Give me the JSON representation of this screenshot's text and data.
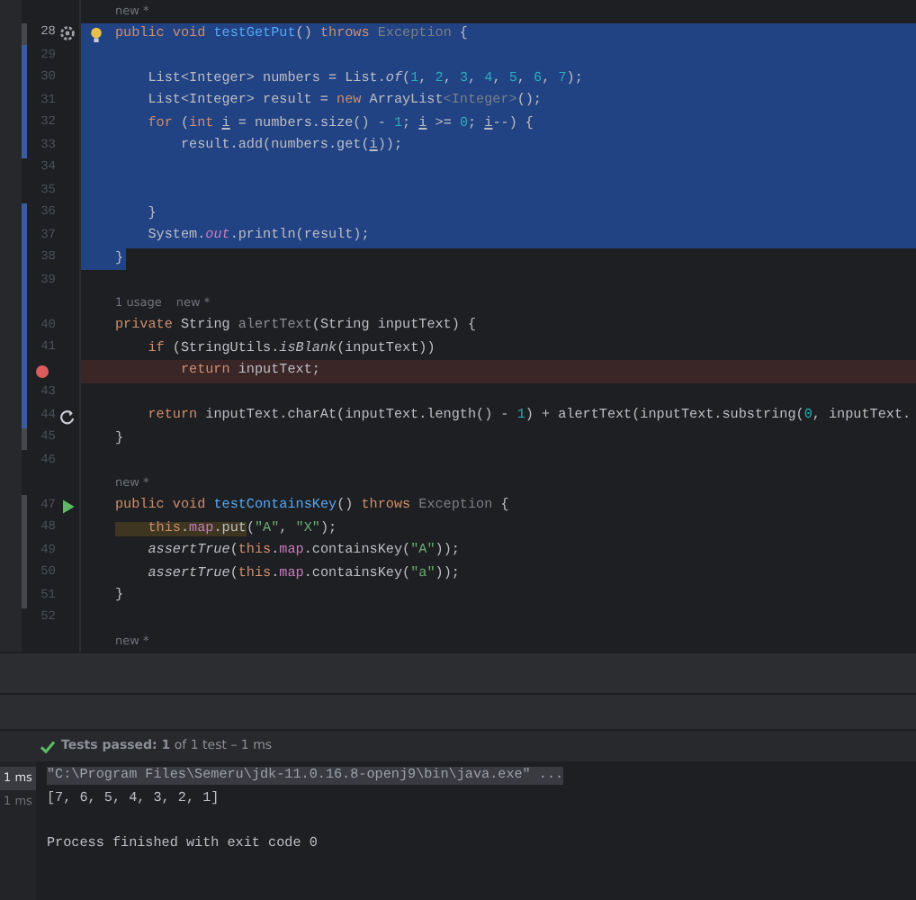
{
  "editor": {
    "rows": [
      {
        "kind": "hint",
        "hints": [
          "new *"
        ]
      },
      {
        "kind": "code",
        "number": "28",
        "current": true,
        "color": "#45474d",
        "gutter_icon": {
          "kind": "run-gear"
        },
        "bulb": true,
        "selected": true,
        "tokens": [
          {
            "text": "public ",
            "kind": "kw"
          },
          {
            "text": "void ",
            "kind": "kw"
          },
          {
            "text": "testGetPut",
            "kind": "decl"
          },
          {
            "text": "() ",
            "kind": "plain"
          },
          {
            "text": "throws ",
            "kind": "kw"
          },
          {
            "text": "Exception",
            "kind": "type"
          },
          {
            "text": " {",
            "kind": "plain"
          }
        ]
      },
      {
        "kind": "code",
        "number": "29",
        "color": "#3a5ca0",
        "selected": true,
        "tokens": []
      },
      {
        "kind": "code",
        "number": "30",
        "color": "#3a5ca0",
        "selected": true,
        "tokens": [
          {
            "text": "    List<Integer> numbers = List.",
            "kind": "plain"
          },
          {
            "text": "of",
            "kind": "italic"
          },
          {
            "text": "(",
            "kind": "plain"
          },
          {
            "text": "1",
            "kind": "num"
          },
          {
            "text": ", ",
            "kind": "plain"
          },
          {
            "text": "2",
            "kind": "num"
          },
          {
            "text": ", ",
            "kind": "plain"
          },
          {
            "text": "3",
            "kind": "num"
          },
          {
            "text": ", ",
            "kind": "plain"
          },
          {
            "text": "4",
            "kind": "num"
          },
          {
            "text": ", ",
            "kind": "plain"
          },
          {
            "text": "5",
            "kind": "num"
          },
          {
            "text": ", ",
            "kind": "plain"
          },
          {
            "text": "6",
            "kind": "num"
          },
          {
            "text": ", ",
            "kind": "plain"
          },
          {
            "text": "7",
            "kind": "num"
          },
          {
            "text": ");",
            "kind": "plain"
          }
        ]
      },
      {
        "kind": "code",
        "number": "31",
        "color": "#3a5ca0",
        "selected": true,
        "tokens": [
          {
            "text": "    List<Integer> result = ",
            "kind": "plain"
          },
          {
            "text": "new",
            "kind": "kw"
          },
          {
            "text": " ArrayList",
            "kind": "plain"
          },
          {
            "text": "<Integer>",
            "kind": "type"
          },
          {
            "text": "();",
            "kind": "plain"
          }
        ]
      },
      {
        "kind": "code",
        "number": "32",
        "color": "#3a5ca0",
        "selected": true,
        "tokens": [
          {
            "text": "    for",
            "kind": "kw"
          },
          {
            "text": " (",
            "kind": "plain"
          },
          {
            "text": "int ",
            "kind": "kw"
          },
          {
            "text": "i",
            "kind": "underline"
          },
          {
            "text": " = numbers.size() - ",
            "kind": "plain"
          },
          {
            "text": "1",
            "kind": "num"
          },
          {
            "text": "; ",
            "kind": "plain"
          },
          {
            "text": "i",
            "kind": "underline"
          },
          {
            "text": " >= ",
            "kind": "plain"
          },
          {
            "text": "0",
            "kind": "num"
          },
          {
            "text": "; ",
            "kind": "plain"
          },
          {
            "text": "i",
            "kind": "underline"
          },
          {
            "text": "--) {",
            "kind": "plain"
          }
        ]
      },
      {
        "kind": "code",
        "number": "33",
        "color": "#3a5ca0",
        "selected": true,
        "tokens": [
          {
            "text": "        result.add(numbers.get(",
            "kind": "plain"
          },
          {
            "text": "i",
            "kind": "underline"
          },
          {
            "text": "));",
            "kind": "plain"
          }
        ]
      },
      {
        "kind": "code",
        "number": "34",
        "selected": true,
        "tokens": []
      },
      {
        "kind": "code",
        "number": "35",
        "selected": true,
        "tokens": []
      },
      {
        "kind": "code",
        "number": "36",
        "color": "#3a5ca0",
        "selected": true,
        "tokens": [
          {
            "text": "    }",
            "kind": "plain"
          }
        ]
      },
      {
        "kind": "code",
        "number": "37",
        "color": "#3a5ca0",
        "selected": true,
        "tokens": [
          {
            "text": "    System.",
            "kind": "plain"
          },
          {
            "text": "out",
            "kind": "field_italic"
          },
          {
            "text": ".println(result);",
            "kind": "plain"
          }
        ]
      },
      {
        "kind": "code",
        "number": "38",
        "color": "#3a5ca0",
        "selected": true,
        "tokens": [
          {
            "text": "}",
            "kind": "plain"
          }
        ]
      },
      {
        "kind": "code",
        "number": "39",
        "color": "#3a5ca0",
        "selected": false,
        "tokens": []
      },
      {
        "kind": "hint",
        "color": "#3a5ca0",
        "hints": [
          "1 usage",
          "new *"
        ]
      },
      {
        "kind": "code",
        "number": "40",
        "color": "#3a5ca0",
        "selected": false,
        "tokens": [
          {
            "text": "private",
            "kind": "kw"
          },
          {
            "text": " String ",
            "kind": "plain"
          },
          {
            "text": "alertText",
            "kind": "unused"
          },
          {
            "text": "(String inputText) {",
            "kind": "plain"
          }
        ]
      },
      {
        "kind": "code",
        "number": "41",
        "color": "#3a5ca0",
        "selected": false,
        "tokens": [
          {
            "text": "    if",
            "kind": "kw"
          },
          {
            "text": " (StringUtils.",
            "kind": "plain"
          },
          {
            "text": "isBlank",
            "kind": "italic"
          },
          {
            "text": "(inputText))",
            "kind": "plain"
          }
        ]
      },
      {
        "kind": "code",
        "breakpoint": true,
        "color": "#3a5ca0",
        "selected": false,
        "tokens": [
          {
            "text": "        return",
            "kind": "kw"
          },
          {
            "text": " inputText;",
            "kind": "plain"
          }
        ]
      },
      {
        "kind": "code",
        "number": "43",
        "color": "#3a5ca0",
        "selected": false,
        "tokens": []
      },
      {
        "kind": "code",
        "number": "44",
        "color": "#3a5ca0",
        "gutter_icon": {
          "kind": "recursion"
        },
        "selected": false,
        "tokens": [
          {
            "text": "    return",
            "kind": "kw"
          },
          {
            "text": " inputText.charAt(inputText.length() - ",
            "kind": "plain"
          },
          {
            "text": "1",
            "kind": "num"
          },
          {
            "text": ") + alertText(inputText.substring(",
            "kind": "plain"
          },
          {
            "text": "0",
            "kind": "num"
          },
          {
            "text": ", inputText.",
            "kind": "plain"
          }
        ]
      },
      {
        "kind": "code",
        "number": "45",
        "color": "#45474d",
        "selected": false,
        "tokens": [
          {
            "text": "}",
            "kind": "plain"
          }
        ]
      },
      {
        "kind": "code",
        "number": "46",
        "selected": false,
        "tokens": []
      },
      {
        "kind": "hint",
        "hints": [
          "new *"
        ]
      },
      {
        "kind": "code",
        "number": "47",
        "color": "#45474d",
        "gutter_icon": {
          "kind": "run"
        },
        "selected": false,
        "tokens": [
          {
            "text": "public ",
            "kind": "kw"
          },
          {
            "text": "void ",
            "kind": "kw"
          },
          {
            "text": "testContainsKey",
            "kind": "decl"
          },
          {
            "text": "() ",
            "kind": "plain"
          },
          {
            "text": "throws ",
            "kind": "kw"
          },
          {
            "text": "Exception",
            "kind": "type"
          },
          {
            "text": " {",
            "kind": "plain"
          }
        ]
      },
      {
        "kind": "code",
        "number": "48",
        "color": "#45474d",
        "selected": false,
        "tokens": [
          {
            "text": "    this",
            "kind": "kw",
            "warning": true
          },
          {
            "text": ".",
            "kind": "plain",
            "warning": true
          },
          {
            "text": "map",
            "kind": "field",
            "warning": true
          },
          {
            "text": ".put",
            "kind": "plain",
            "warning": true
          },
          {
            "text": "(",
            "kind": "plain"
          },
          {
            "text": "\"A\"",
            "kind": "str"
          },
          {
            "text": ", ",
            "kind": "plain"
          },
          {
            "text": "\"X\"",
            "kind": "str"
          },
          {
            "text": ");",
            "kind": "plain"
          }
        ]
      },
      {
        "kind": "code",
        "number": "49",
        "color": "#45474d",
        "selected": false,
        "tokens": [
          {
            "text": "    assertTrue",
            "kind": "italic"
          },
          {
            "text": "(",
            "kind": "plain"
          },
          {
            "text": "this",
            "kind": "kw"
          },
          {
            "text": ".",
            "kind": "plain"
          },
          {
            "text": "map",
            "kind": "field"
          },
          {
            "text": ".containsKey(",
            "kind": "plain"
          },
          {
            "text": "\"A\"",
            "kind": "str"
          },
          {
            "text": "));",
            "kind": "plain"
          }
        ]
      },
      {
        "kind": "code",
        "number": "50",
        "color": "#45474d",
        "selected": false,
        "tokens": [
          {
            "text": "    assertTrue",
            "kind": "italic"
          },
          {
            "text": "(",
            "kind": "plain"
          },
          {
            "text": "this",
            "kind": "kw"
          },
          {
            "text": ".",
            "kind": "plain"
          },
          {
            "text": "map",
            "kind": "field"
          },
          {
            "text": ".containsKey(",
            "kind": "plain"
          },
          {
            "text": "\"a\"",
            "kind": "str"
          },
          {
            "text": "));",
            "kind": "plain"
          }
        ]
      },
      {
        "kind": "code",
        "number": "51",
        "color": "#45474d",
        "selected": false,
        "tokens": [
          {
            "text": "}",
            "kind": "plain"
          }
        ]
      },
      {
        "kind": "code",
        "number": "52",
        "selected": false,
        "tokens": []
      },
      {
        "kind": "hint",
        "hints": [
          "new *"
        ]
      }
    ]
  },
  "test_results": {
    "status": "**Tests passed: 1** of 1 test – 1 ms",
    "tree": [
      {
        "label": "1 ms",
        "selected": true
      },
      {
        "label": "1 ms",
        "selected": false
      }
    ],
    "console": [
      {
        "kind": "command",
        "text": "\"C:\\Program Files\\Semeru\\jdk-11.0.16.8-openj9\\bin\\java.exe\" ..."
      },
      {
        "kind": "output",
        "text": "[7, 6, 5, 4, 3, 2, 1]"
      },
      {
        "kind": "blank"
      },
      {
        "kind": "output",
        "text": "Process finished with exit code 0"
      }
    ]
  }
}
